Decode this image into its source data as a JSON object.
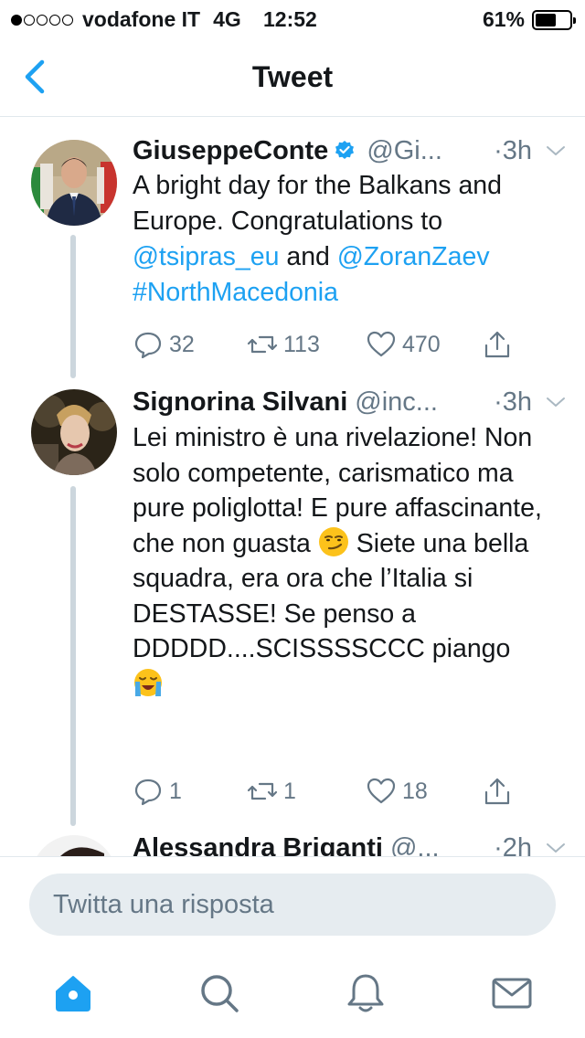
{
  "status": {
    "carrier": "vodafone IT",
    "network": "4G",
    "time": "12:52",
    "battery": "61%",
    "battery_level": 0.61,
    "signal_bars": 1
  },
  "nav": {
    "title": "Tweet",
    "back_icon": "chevron-left-icon"
  },
  "tweets": [
    {
      "name": "GiuseppeConte",
      "verified": true,
      "handle": "@Gi...",
      "time": "·3h",
      "text_parts": [
        "A bright day for the Balkans and Europe. Congratulations to ",
        "@tsipras_eu",
        " and ",
        "@ZoranZaev",
        "#NorthMacedonia"
      ],
      "replies": "32",
      "retweets": "113",
      "likes": "470"
    },
    {
      "name": "Signorina Silvani",
      "handle": "@inc...",
      "time": "·3h",
      "text_1": "Lei ministro è una rivelazione! Non solo competente, carismatico ma pure poliglotta! E pure affascinante, che non guasta",
      "text_2": "Siete una bella squadra, era ora che l’Italia si DESTASSE! Se penso a DDDDD....SCISSSSCCC piango",
      "emoji_1": "smirking-face-emoji",
      "emoji_2": "loudly-crying-face-emoji",
      "replies": "1",
      "retweets": "1",
      "likes": "18"
    },
    {
      "name": "Alessandra Briganti",
      "handle": "@...",
      "time": "·2h"
    }
  ],
  "reply": {
    "placeholder": "Twitta una risposta"
  },
  "tabs": [
    "home-icon",
    "search-icon",
    "notifications-icon",
    "messages-icon"
  ],
  "colors": {
    "accent": "#1da1f2",
    "muted": "#657786",
    "line": "#ccd6dd"
  }
}
